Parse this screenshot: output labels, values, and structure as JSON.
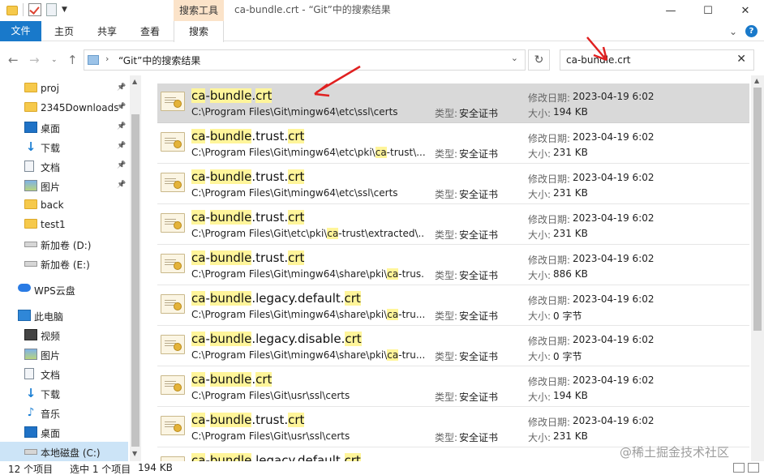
{
  "window": {
    "title": "ca-bundle.crt - “Git”中的搜索结果",
    "context_tab": "搜索工具",
    "controls": {
      "minimize": "—",
      "maximize": "☐",
      "close": "✕"
    }
  },
  "ribbon": {
    "tabs": [
      "文件",
      "主页",
      "共享",
      "查看",
      "搜索"
    ],
    "active_tab": "搜索",
    "collapse": "⌄",
    "help": "?"
  },
  "address": {
    "path": "“Git”中的搜索结果",
    "search_value": "ca-bundle.crt"
  },
  "nav": {
    "items": [
      {
        "label": "proj",
        "icon": "folder-icon",
        "pinned": true
      },
      {
        "label": "2345Downloads",
        "icon": "folder-icon",
        "pinned": true
      },
      {
        "label": "桌面",
        "icon": "desktop-icon",
        "pinned": true
      },
      {
        "label": "下载",
        "icon": "download-icon",
        "pinned": true
      },
      {
        "label": "文档",
        "icon": "document-icon",
        "pinned": true
      },
      {
        "label": "图片",
        "icon": "picture-icon",
        "pinned": true
      },
      {
        "label": "back",
        "icon": "folder-icon",
        "pinned": false
      },
      {
        "label": "test1",
        "icon": "folder-icon",
        "pinned": false
      },
      {
        "label": "新加卷 (D:)",
        "icon": "drive-icon",
        "pinned": false
      },
      {
        "label": "新加卷 (E:)",
        "icon": "drive-icon",
        "pinned": false
      },
      {
        "label": "WPS云盘",
        "icon": "cloud-icon",
        "pinned": false
      },
      {
        "label": "此电脑",
        "icon": "pc-icon",
        "pinned": false
      },
      {
        "label": "视频",
        "icon": "video-icon",
        "pinned": false
      },
      {
        "label": "图片",
        "icon": "picture-icon",
        "pinned": false
      },
      {
        "label": "文档",
        "icon": "document-icon",
        "pinned": false
      },
      {
        "label": "下载",
        "icon": "download-icon",
        "pinned": false
      },
      {
        "label": "音乐",
        "icon": "music-icon",
        "pinned": false
      },
      {
        "label": "桌面",
        "icon": "desktop-icon",
        "pinned": false
      },
      {
        "label": "本地磁盘 (C:)",
        "icon": "drive-icon",
        "pinned": false,
        "selected": true
      }
    ]
  },
  "results": {
    "type_label": "类型:",
    "date_label": "修改日期:",
    "size_label": "大小:",
    "items": [
      {
        "name_parts": [
          [
            "ca",
            true
          ],
          [
            "-",
            false
          ],
          [
            "bundle",
            true
          ],
          [
            ".",
            false
          ],
          [
            "crt",
            true
          ]
        ],
        "path_parts": [
          [
            "C:\\Program Files\\Git\\mingw64\\etc\\ssl\\certs",
            false
          ]
        ],
        "type": "安全证书",
        "date": "2023-04-19 6:02",
        "size": "194 KB",
        "selected": true
      },
      {
        "name_parts": [
          [
            "ca",
            true
          ],
          [
            "-",
            false
          ],
          [
            "bundle",
            true
          ],
          [
            ".trust.",
            false
          ],
          [
            "crt",
            true
          ]
        ],
        "path_parts": [
          [
            "C:\\Program Files\\Git\\mingw64\\etc\\pki\\",
            false
          ],
          [
            "ca",
            true
          ],
          [
            "-trust\\...",
            false
          ]
        ],
        "type": "安全证书",
        "date": "2023-04-19 6:02",
        "size": "231 KB"
      },
      {
        "name_parts": [
          [
            "ca",
            true
          ],
          [
            "-",
            false
          ],
          [
            "bundle",
            true
          ],
          [
            ".trust.",
            false
          ],
          [
            "crt",
            true
          ]
        ],
        "path_parts": [
          [
            "C:\\Program Files\\Git\\mingw64\\etc\\ssl\\certs",
            false
          ]
        ],
        "type": "安全证书",
        "date": "2023-04-19 6:02",
        "size": "231 KB"
      },
      {
        "name_parts": [
          [
            "ca",
            true
          ],
          [
            "-",
            false
          ],
          [
            "bundle",
            true
          ],
          [
            ".trust.",
            false
          ],
          [
            "crt",
            true
          ]
        ],
        "path_parts": [
          [
            "C:\\Program Files\\Git\\etc\\pki\\",
            false
          ],
          [
            "ca",
            true
          ],
          [
            "-trust\\extracted\\...",
            false
          ]
        ],
        "type": "安全证书",
        "date": "2023-04-19 6:02",
        "size": "231 KB"
      },
      {
        "name_parts": [
          [
            "ca",
            true
          ],
          [
            "-",
            false
          ],
          [
            "bundle",
            true
          ],
          [
            ".trust.",
            false
          ],
          [
            "crt",
            true
          ]
        ],
        "path_parts": [
          [
            "C:\\Program Files\\Git\\mingw64\\share\\pki\\",
            false
          ],
          [
            "ca",
            true
          ],
          [
            "-trus...",
            false
          ]
        ],
        "type": "安全证书",
        "date": "2023-04-19 6:02",
        "size": "886 KB"
      },
      {
        "name_parts": [
          [
            "ca",
            true
          ],
          [
            "-",
            false
          ],
          [
            "bundle",
            true
          ],
          [
            ".legacy.default.",
            false
          ],
          [
            "crt",
            true
          ]
        ],
        "path_parts": [
          [
            "C:\\Program Files\\Git\\mingw64\\share\\pki\\",
            false
          ],
          [
            "ca",
            true
          ],
          [
            "-tru...",
            false
          ]
        ],
        "type": "安全证书",
        "date": "2023-04-19 6:02",
        "size": "0 字节"
      },
      {
        "name_parts": [
          [
            "ca",
            true
          ],
          [
            "-",
            false
          ],
          [
            "bundle",
            true
          ],
          [
            ".legacy.disable.",
            false
          ],
          [
            "crt",
            true
          ]
        ],
        "path_parts": [
          [
            "C:\\Program Files\\Git\\mingw64\\share\\pki\\",
            false
          ],
          [
            "ca",
            true
          ],
          [
            "-tru...",
            false
          ]
        ],
        "type": "安全证书",
        "date": "2023-04-19 6:02",
        "size": "0 字节"
      },
      {
        "name_parts": [
          [
            "ca",
            true
          ],
          [
            "-",
            false
          ],
          [
            "bundle",
            true
          ],
          [
            ".",
            false
          ],
          [
            "crt",
            true
          ]
        ],
        "path_parts": [
          [
            "C:\\Program Files\\Git\\usr\\ssl\\certs",
            false
          ]
        ],
        "type": "安全证书",
        "date": "2023-04-19 6:02",
        "size": "194 KB"
      },
      {
        "name_parts": [
          [
            "ca",
            true
          ],
          [
            "-",
            false
          ],
          [
            "bundle",
            true
          ],
          [
            ".trust.",
            false
          ],
          [
            "crt",
            true
          ]
        ],
        "path_parts": [
          [
            "C:\\Program Files\\Git\\usr\\ssl\\certs",
            false
          ]
        ],
        "type": "安全证书",
        "date": "2023-04-19 6:02",
        "size": "231 KB"
      },
      {
        "name_parts": [
          [
            "ca",
            true
          ],
          [
            "-",
            false
          ],
          [
            "bundle",
            true
          ],
          [
            ".legacy.default.",
            false
          ],
          [
            "crt",
            true
          ]
        ],
        "path_parts": [],
        "type": "",
        "date": "",
        "size": ""
      }
    ]
  },
  "status": {
    "count": "12 个项目",
    "selection": "选中 1 个项目",
    "selection_size": "194 KB"
  },
  "watermark": "@稀土掘金技术社区",
  "colors": {
    "file_tab": "#1979ca",
    "context_tab": "#fbe3c9",
    "highlight": "#fff59a",
    "selected_row": "#d9d9d9",
    "annotation": "#e02020"
  }
}
